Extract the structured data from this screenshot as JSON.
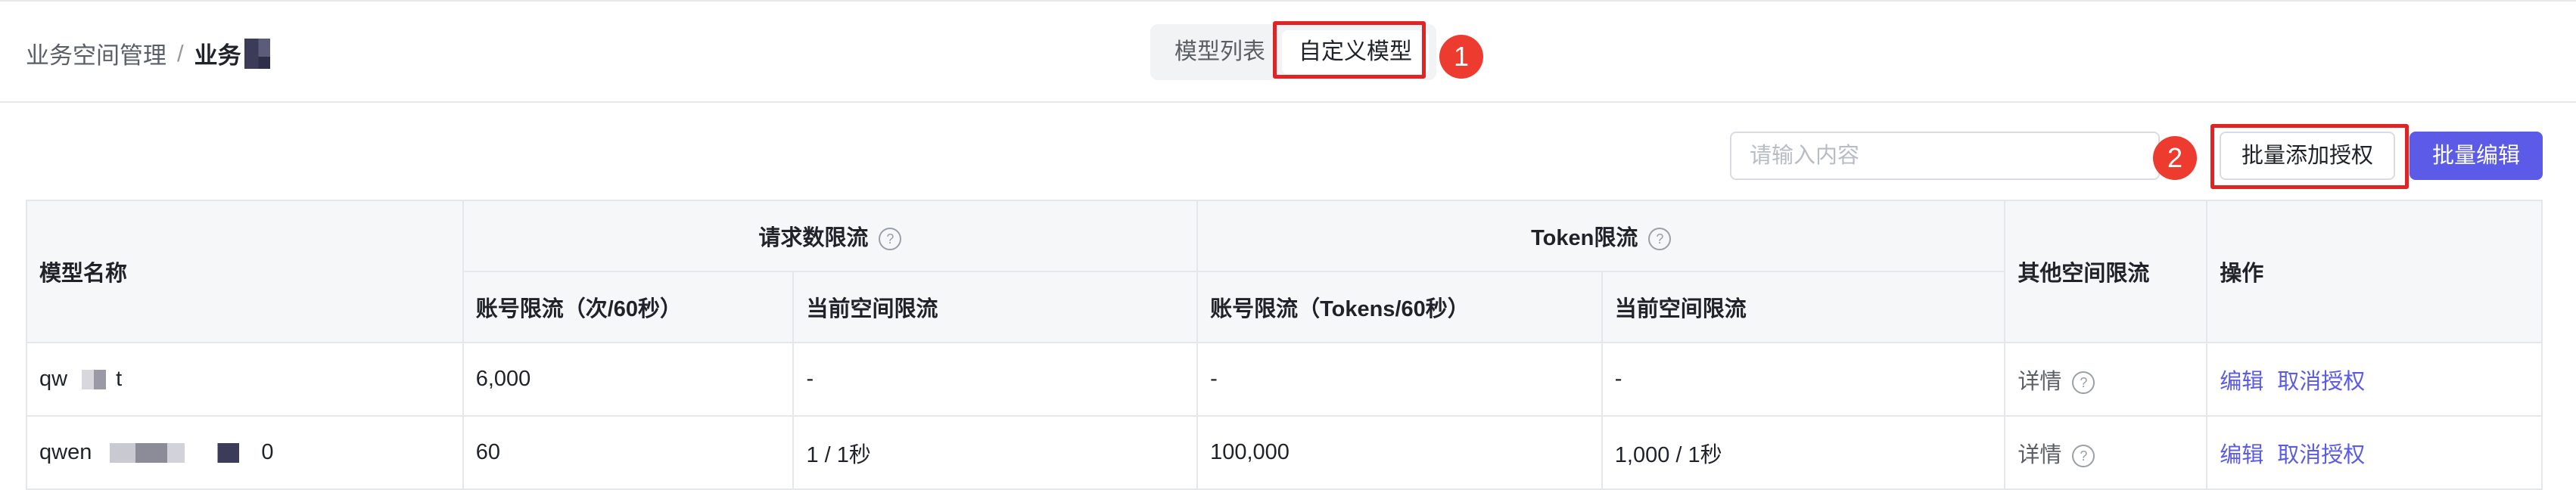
{
  "breadcrumb": {
    "parent": "业务空间管理",
    "separator": "/",
    "current": "业务"
  },
  "tabs": [
    {
      "label": "模型列表",
      "active": false
    },
    {
      "label": "自定义模型",
      "active": true
    }
  ],
  "annotations": {
    "step1": "1",
    "step2": "2",
    "highlight_color": "#e02424",
    "badge_color": "#ee3b2f"
  },
  "toolbar": {
    "search_placeholder": "请输入内容",
    "batch_add_auth_label": "批量添加授权",
    "batch_edit_label": "批量编辑",
    "accent_color": "#5b5be8"
  },
  "table": {
    "headers": {
      "model_name": "模型名称",
      "request_limit": "请求数限流",
      "token_limit": "Token限流",
      "other_space_limit": "其他空间限流",
      "actions": "操作",
      "account_limit_req": "账号限流（次/60秒）",
      "current_space_limit_req": "当前空间限流",
      "account_limit_token": "账号限流（Tokens/60秒）",
      "current_space_limit_token": "当前空间限流"
    },
    "rows": [
      {
        "name_prefix": "qw",
        "name_suffix": "t",
        "account_req": "6,000",
        "space_req": "-",
        "account_token": "-",
        "space_token": "-",
        "detail": "详情",
        "edit": "编辑",
        "revoke": "取消授权"
      },
      {
        "name_prefix": "qwen",
        "name_suffix": "0",
        "account_req": "60",
        "space_req": "1 / 1秒",
        "account_token": "100,000",
        "space_token": "1,000 / 1秒",
        "detail": "详情",
        "edit": "编辑",
        "revoke": "取消授权"
      }
    ]
  }
}
